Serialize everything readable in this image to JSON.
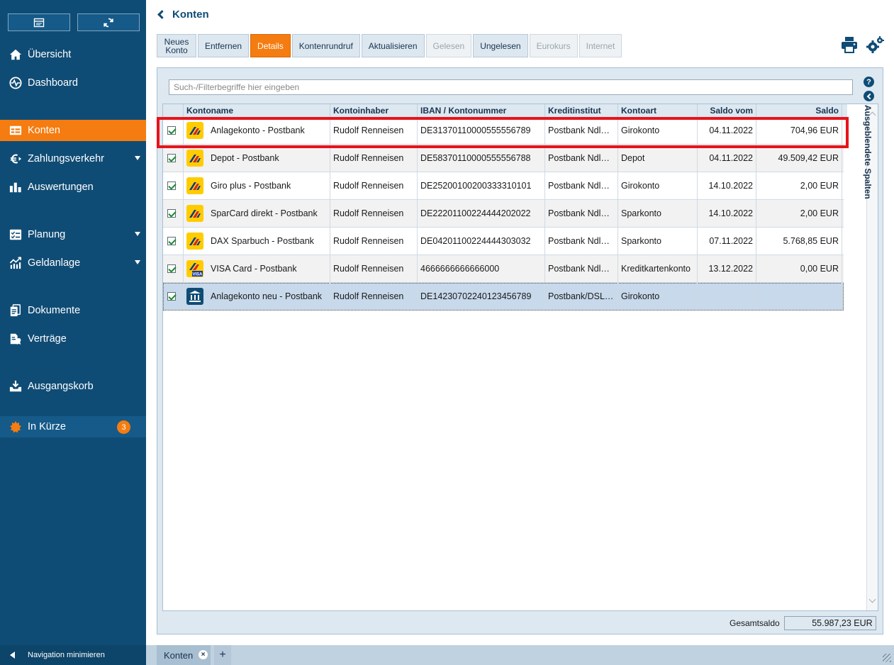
{
  "sidebar": {
    "nav": [
      {
        "label": "Übersicht"
      },
      {
        "label": "Dashboard"
      },
      {
        "label": "Konten"
      },
      {
        "label": "Zahlungsverkehr"
      },
      {
        "label": "Auswertungen"
      },
      {
        "label": "Planung"
      },
      {
        "label": "Geldanlage"
      },
      {
        "label": "Dokumente"
      },
      {
        "label": "Verträge"
      },
      {
        "label": "Ausgangskorb"
      },
      {
        "label": "In Kürze",
        "badge": "3"
      }
    ],
    "minimize_label": "Navigation minimieren"
  },
  "header": {
    "title": "Konten"
  },
  "toolbar": {
    "buttons": [
      {
        "label": "Neues\nKonto",
        "state": "normal"
      },
      {
        "label": "Entfernen",
        "state": "normal"
      },
      {
        "label": "Details",
        "state": "active"
      },
      {
        "label": "Kontenrundruf",
        "state": "normal"
      },
      {
        "label": "Aktualisieren",
        "state": "normal"
      },
      {
        "label": "Gelesen",
        "state": "disabled"
      },
      {
        "label": "Ungelesen",
        "state": "normal"
      },
      {
        "label": "Eurokurs",
        "state": "disabled"
      },
      {
        "label": "Internet",
        "state": "disabled"
      }
    ]
  },
  "search": {
    "placeholder": "Such-/Filterbegriffe hier eingeben"
  },
  "table": {
    "columns": [
      "Kontoname",
      "Kontoinhaber",
      "IBAN / Kontonummer",
      "Kreditinstitut",
      "Kontoart",
      "Saldo vom",
      "Saldo"
    ],
    "rows": [
      {
        "name": "Anlagekonto - Postbank",
        "owner": "Rudolf Renneisen",
        "iban": "DE31370110000555556789",
        "bank": "Postbank Ndl…",
        "type": "Girokonto",
        "date": "04.11.2022",
        "balance": "704,96 EUR",
        "icon": "postbank-logo-icon"
      },
      {
        "name": "Depot - Postbank",
        "owner": "Rudolf Renneisen",
        "iban": "DE58370110000555556788",
        "bank": "Postbank Ndl…",
        "type": "Depot",
        "date": "04.11.2022",
        "balance": "49.509,42 EUR",
        "icon": "postbank-logo-icon"
      },
      {
        "name": "Giro plus - Postbank",
        "owner": "Rudolf Renneisen",
        "iban": "DE25200100200333310101",
        "bank": "Postbank Ndl…",
        "type": "Girokonto",
        "date": "14.10.2022",
        "balance": "2,00 EUR",
        "icon": "postbank-logo-icon"
      },
      {
        "name": "SparCard direkt - Postbank",
        "owner": "Rudolf Renneisen",
        "iban": "DE22201100224444202022",
        "bank": "Postbank Ndl…",
        "type": "Sparkonto",
        "date": "14.10.2022",
        "balance": "2,00 EUR",
        "icon": "postbank-logo-icon"
      },
      {
        "name": "DAX Sparbuch - Postbank",
        "owner": "Rudolf Renneisen",
        "iban": "DE04201100224444303032",
        "bank": "Postbank Ndl…",
        "type": "Sparkonto",
        "date": "07.11.2022",
        "balance": "5.768,85 EUR",
        "icon": "postbank-logo-icon"
      },
      {
        "name": "VISA Card - Postbank",
        "owner": "Rudolf Renneisen",
        "iban": "4666666666666000",
        "bank": "Postbank Ndl…",
        "type": "Kreditkartenkonto",
        "date": "13.12.2022",
        "balance": "0,00 EUR",
        "icon": "visa-card-icon",
        "icon_badge": "VISA"
      },
      {
        "name": "Anlagekonto neu - Postbank",
        "owner": "Rudolf Renneisen",
        "iban": "DE14230702240123456789",
        "bank": "Postbank/DSL…",
        "type": "Girokonto",
        "date": "",
        "balance": "",
        "icon": "bank-building-icon"
      }
    ]
  },
  "side_panel": {
    "label": "Ausgeblendete Spalten",
    "help": "?"
  },
  "total": {
    "label": "Gesamtsaldo",
    "value": "55.987,23 EUR"
  },
  "tabs": [
    {
      "label": "Konten",
      "close": "×"
    }
  ],
  "add_tab_label": "+",
  "colors": {
    "sidebar": "#0f4c75",
    "accent": "#f57c10",
    "highlight": "#e8131a",
    "postbank_yellow": "#ffcc00"
  }
}
